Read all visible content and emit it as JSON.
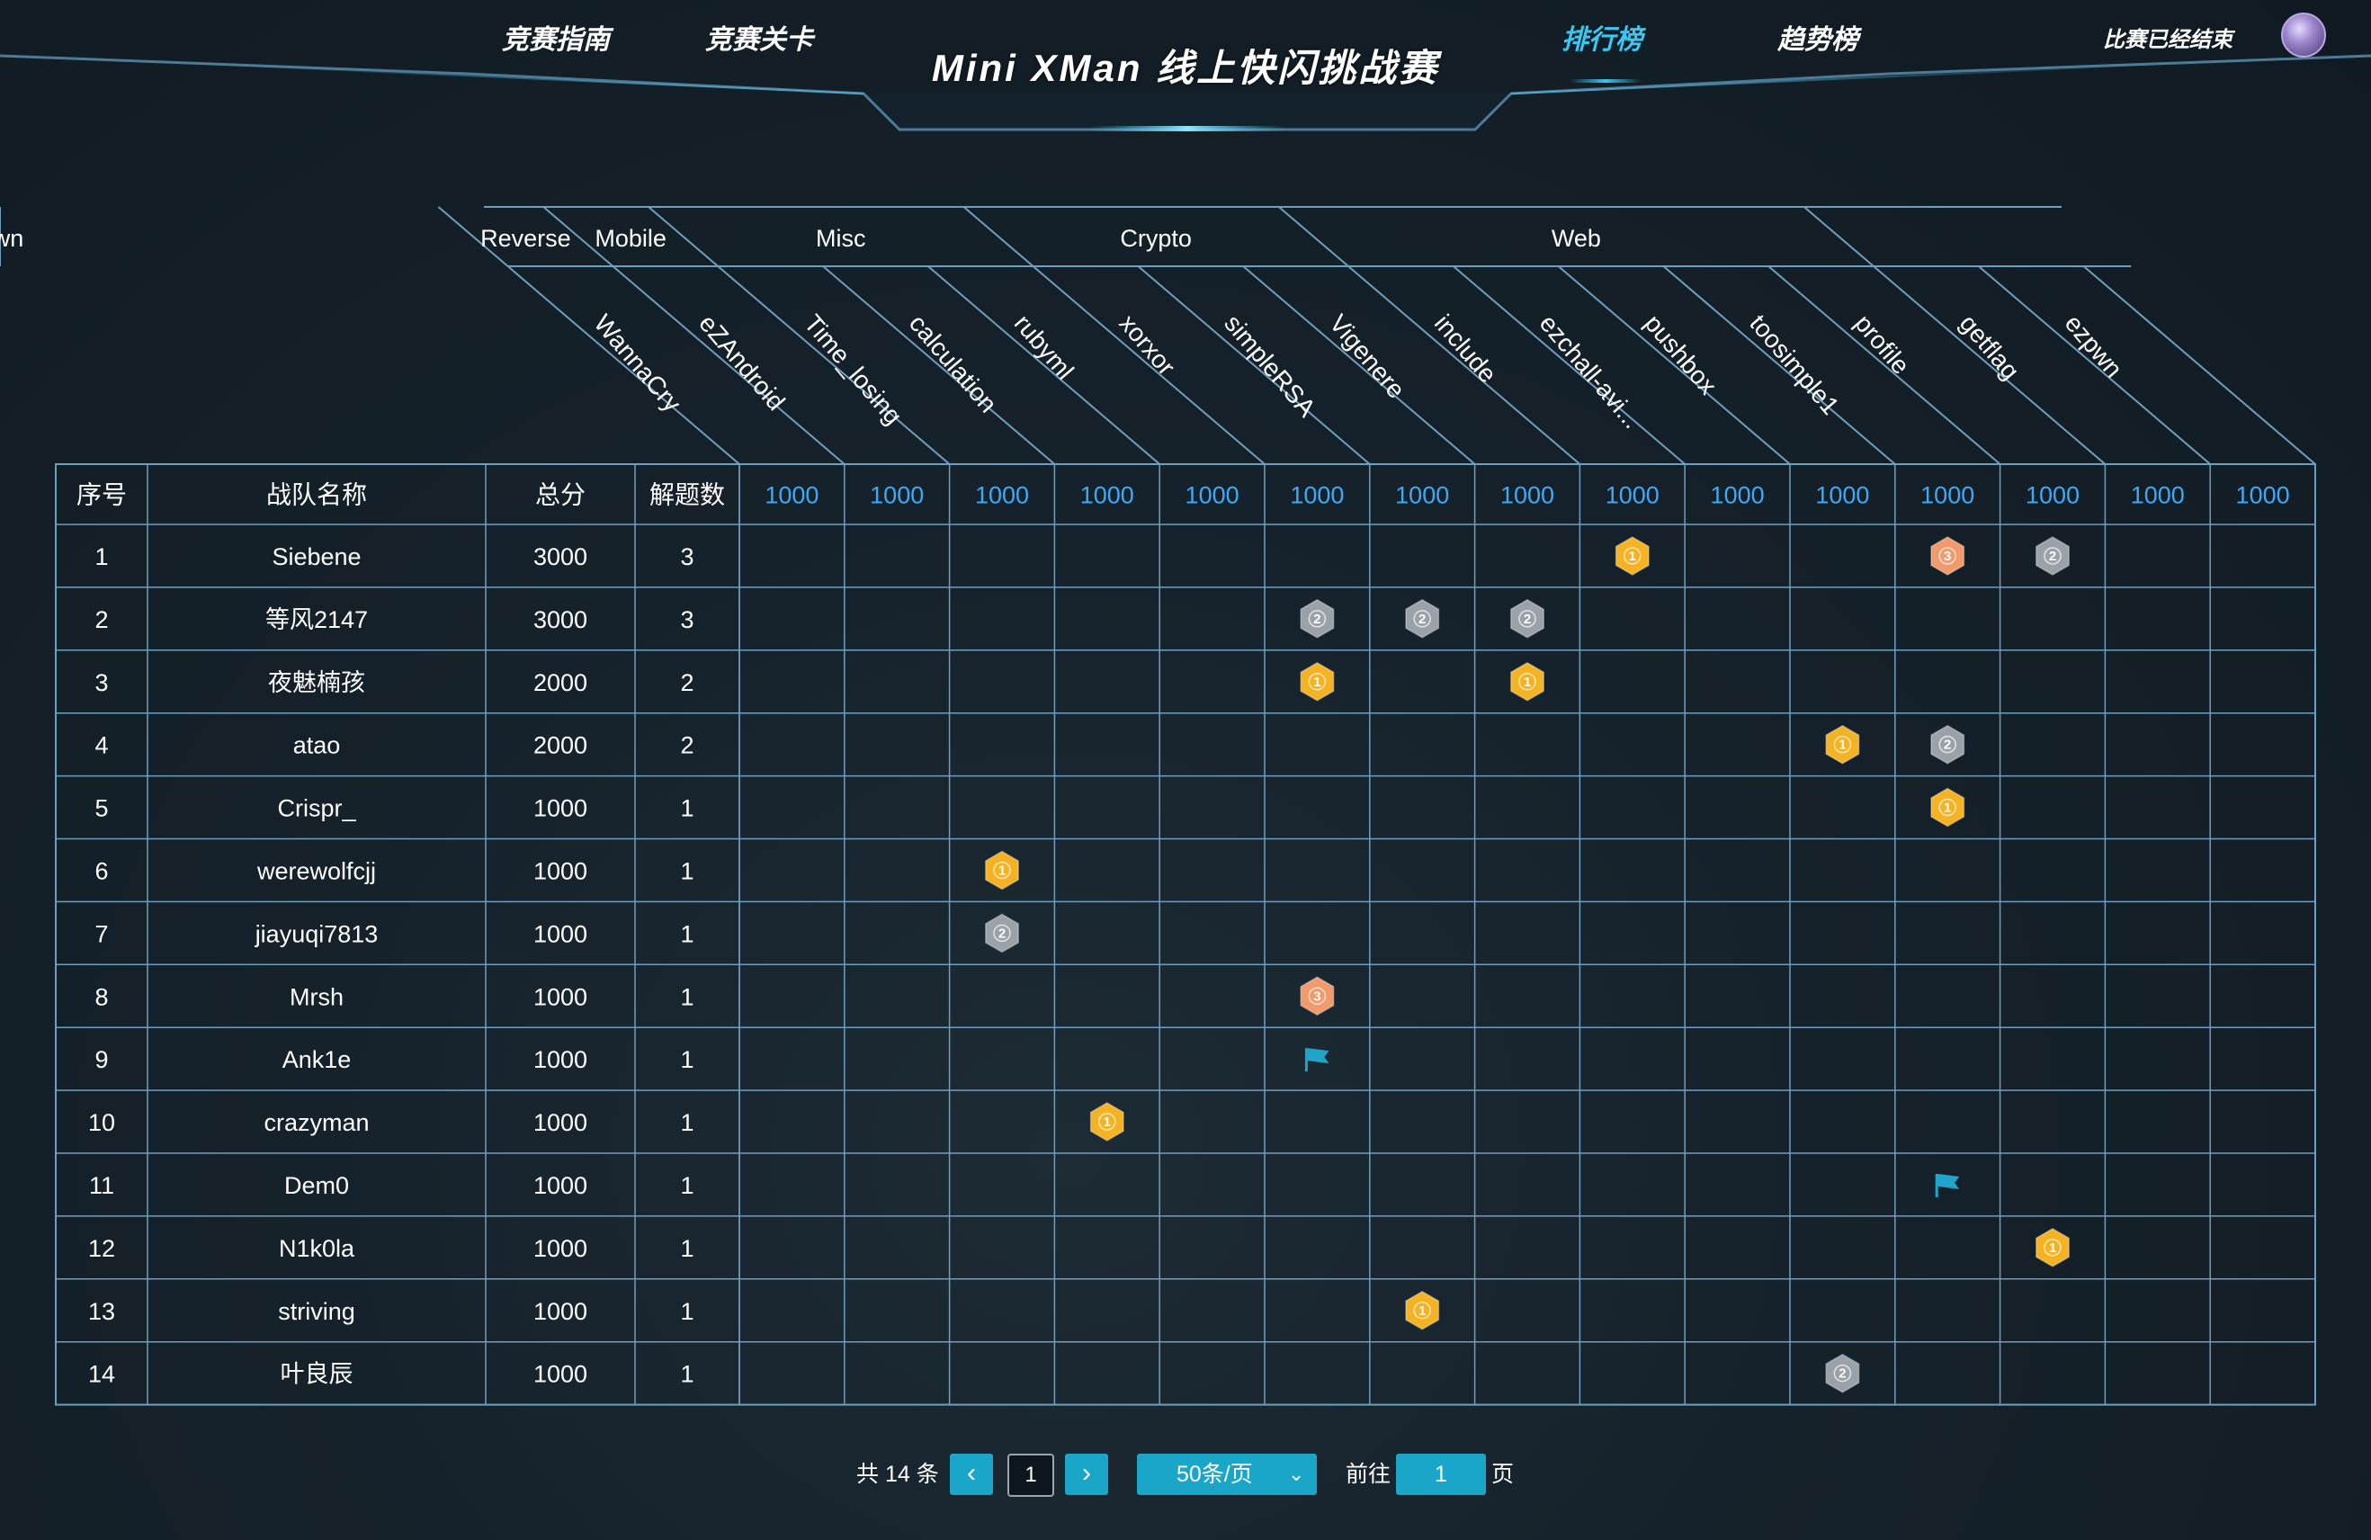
{
  "nav": {
    "links": [
      {
        "label": "竞赛指南",
        "active": false
      },
      {
        "label": "竞赛关卡",
        "active": false
      },
      {
        "label": "排行榜",
        "active": true
      },
      {
        "label": "趋势榜",
        "active": false
      }
    ],
    "title": "Mini  XMan  线上快闪挑战赛",
    "status": "比赛已经结束"
  },
  "scoreboard": {
    "categories": [
      {
        "name": "Reverse",
        "span": 1
      },
      {
        "name": "Mobile",
        "span": 1
      },
      {
        "name": "Misc",
        "span": 3
      },
      {
        "name": "Crypto",
        "span": 3
      },
      {
        "name": "Web",
        "span": 5
      },
      {
        "name": "Pwn",
        "span": 3
      }
    ],
    "challenges": [
      "WannaCry",
      "eZAndroid",
      "Time_losing",
      "calculation",
      "rubyml",
      "xorxor",
      "simpleRSA",
      "Vigenere",
      "include",
      "ezchall-avi...",
      "pushbox",
      "toosimple1",
      "profile",
      "getflag",
      "ezpwn"
    ],
    "challenge_scores": [
      "1000",
      "1000",
      "1000",
      "1000",
      "1000",
      "1000",
      "1000",
      "1000",
      "1000",
      "1000",
      "1000",
      "1000",
      "1000",
      "1000",
      "1000"
    ],
    "columns": {
      "rank": "序号",
      "team": "战队名称",
      "total": "总分",
      "solves": "解题数"
    },
    "teams": [
      {
        "rank": "1",
        "name": "Siebene",
        "score": "3000",
        "solved": "3"
      },
      {
        "rank": "2",
        "name": "等风2147",
        "score": "3000",
        "solved": "3"
      },
      {
        "rank": "3",
        "name": "夜魅楠孩",
        "score": "2000",
        "solved": "2"
      },
      {
        "rank": "4",
        "name": "atao",
        "score": "2000",
        "solved": "2"
      },
      {
        "rank": "5",
        "name": "Crispr_",
        "score": "1000",
        "solved": "1"
      },
      {
        "rank": "6",
        "name": "werewolfcjj",
        "score": "1000",
        "solved": "1"
      },
      {
        "rank": "7",
        "name": "jiayuqi7813",
        "score": "1000",
        "solved": "1"
      },
      {
        "rank": "8",
        "name": "Mrsh",
        "score": "1000",
        "solved": "1"
      },
      {
        "rank": "9",
        "name": "Ank1e",
        "score": "1000",
        "solved": "1"
      },
      {
        "rank": "10",
        "name": "crazyman",
        "score": "1000",
        "solved": "1"
      },
      {
        "rank": "11",
        "name": "Dem0",
        "score": "1000",
        "solved": "1"
      },
      {
        "rank": "12",
        "name": "N1k0la",
        "score": "1000",
        "solved": "1"
      },
      {
        "rank": "13",
        "name": "striving",
        "score": "1000",
        "solved": "1"
      },
      {
        "rank": "14",
        "name": "叶良辰",
        "score": "1000",
        "solved": "1"
      }
    ],
    "solves": [
      {
        "row": 0,
        "col": 8,
        "mark": "1"
      },
      {
        "row": 0,
        "col": 11,
        "mark": "3"
      },
      {
        "row": 0,
        "col": 12,
        "mark": "2"
      },
      {
        "row": 1,
        "col": 5,
        "mark": "2"
      },
      {
        "row": 1,
        "col": 6,
        "mark": "2"
      },
      {
        "row": 1,
        "col": 7,
        "mark": "2"
      },
      {
        "row": 2,
        "col": 5,
        "mark": "1"
      },
      {
        "row": 2,
        "col": 7,
        "mark": "1"
      },
      {
        "row": 3,
        "col": 10,
        "mark": "1"
      },
      {
        "row": 3,
        "col": 11,
        "mark": "2"
      },
      {
        "row": 4,
        "col": 11,
        "mark": "1"
      },
      {
        "row": 5,
        "col": 2,
        "mark": "1"
      },
      {
        "row": 6,
        "col": 2,
        "mark": "2"
      },
      {
        "row": 7,
        "col": 5,
        "mark": "3"
      },
      {
        "row": 8,
        "col": 5,
        "mark": "flag"
      },
      {
        "row": 9,
        "col": 3,
        "mark": "1"
      },
      {
        "row": 10,
        "col": 11,
        "mark": "flag"
      },
      {
        "row": 11,
        "col": 12,
        "mark": "1"
      },
      {
        "row": 12,
        "col": 6,
        "mark": "1"
      },
      {
        "row": 13,
        "col": 10,
        "mark": "2"
      }
    ],
    "medal_colors": {
      "1": "#f5b223",
      "2": "#9aa1a9",
      "3": "#f19a6c",
      "flag": "#20a4c9"
    }
  },
  "pagination": {
    "total_text": "共 14 条",
    "prev_icon": "chevron-left-icon",
    "current_page": "1",
    "next_icon": "chevron-right-icon",
    "page_size": "50条/页",
    "goto_label": "前往",
    "goto_value": "1",
    "page_suffix": "页"
  }
}
